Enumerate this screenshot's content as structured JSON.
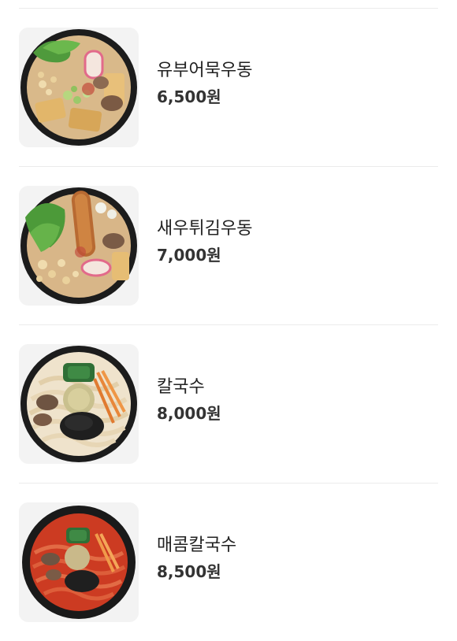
{
  "menu": {
    "items": [
      {
        "name": "유부어묵우동",
        "price": "6,500원",
        "image_icon": "udon-fishcake-tofu-photo"
      },
      {
        "name": "새우튀김우동",
        "price": "7,000원",
        "image_icon": "udon-shrimp-tempura-photo"
      },
      {
        "name": "칼국수",
        "price": "8,000원",
        "image_icon": "kalguksu-photo"
      },
      {
        "name": "매콤칼국수",
        "price": "8,500원",
        "image_icon": "spicy-kalguksu-photo"
      }
    ]
  },
  "colors": {
    "background": "#ffffff",
    "divider": "#ebebeb",
    "name_text": "#222222",
    "price_text": "#333333"
  }
}
